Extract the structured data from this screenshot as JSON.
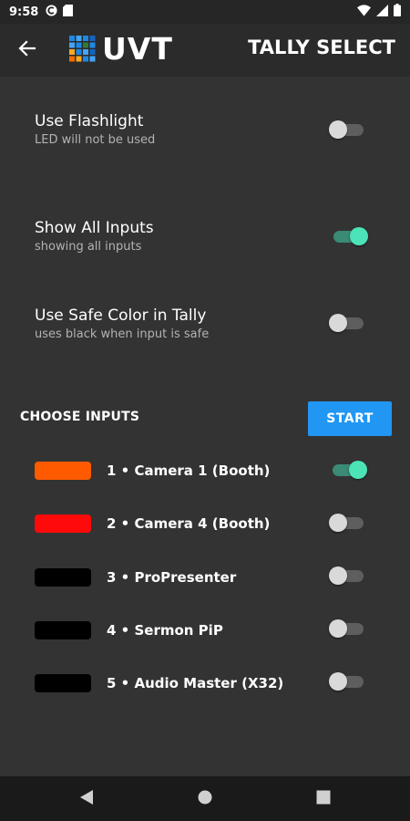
{
  "status_bar": {
    "time": "9:58",
    "left_icons": [
      "chrome-c-icon",
      "sd-card-icon"
    ],
    "right_icons": [
      "wifi-icon",
      "signal-icon",
      "battery-icon"
    ]
  },
  "app_bar": {
    "back_icon": "arrow-left-icon",
    "brand": "UVT",
    "title": "TALLY SELECT"
  },
  "settings": [
    {
      "title": "Use Flashlight",
      "subtitle": "LED will not be used",
      "on": false
    },
    {
      "title": "Show All Inputs",
      "subtitle": "showing all inputs",
      "on": true
    },
    {
      "title": "Use Safe Color in Tally",
      "subtitle": "uses black when input is safe",
      "on": false
    }
  ],
  "inputs_section": {
    "header": "CHOOSE INPUTS",
    "start_label": "START"
  },
  "inputs": [
    {
      "label": "1 • Camera 1 (Booth)",
      "color": "#ff5a00",
      "on": true
    },
    {
      "label": "2 • Camera 4 (Booth)",
      "color": "#ff0a0a",
      "on": false
    },
    {
      "label": "3 • ProPresenter",
      "color": "#000000",
      "on": false
    },
    {
      "label": "4 • Sermon PiP",
      "color": "#000000",
      "on": false
    },
    {
      "label": "5 • Audio Master (X32)",
      "color": "#000000",
      "on": false
    }
  ],
  "colors": {
    "background": "#333333",
    "app_bar": "#2b2b2b",
    "accent": "#4de3b8",
    "start_button": "#2196f3"
  }
}
